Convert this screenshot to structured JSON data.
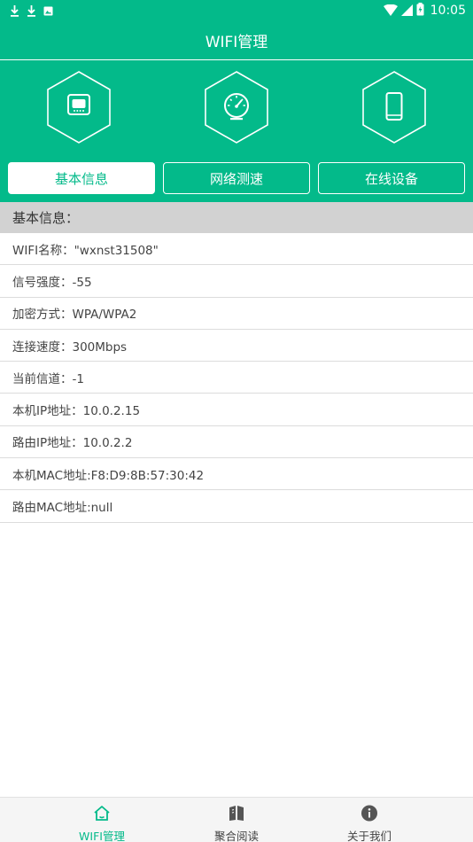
{
  "status_bar": {
    "time": "10:05",
    "left_icons": [
      "download-icon",
      "download-icon",
      "photo-icon"
    ],
    "right_icons": [
      "wifi-signal-icon",
      "cell-signal-icon",
      "battery-icon"
    ]
  },
  "title_bar": {
    "title": "WIFI管理"
  },
  "header": {
    "hex_icons": [
      "router-icon",
      "speedometer-icon",
      "phone-icon"
    ],
    "tabs": [
      {
        "label": "基本信息",
        "active": true
      },
      {
        "label": "网络测速",
        "active": false
      },
      {
        "label": "在线设备",
        "active": false
      }
    ]
  },
  "section": {
    "title": "基本信息：",
    "rows": [
      "WIFI名称：\"wxnst31508\"",
      "信号强度：-55",
      "加密方式：WPA/WPA2",
      "连接速度：300Mbps",
      "当前信道：-1",
      "本机IP地址：10.0.2.15",
      "路由IP地址：10.0.2.2",
      "本机MAC地址:F8:D9:8B:57:30:42",
      "路由MAC地址:null"
    ]
  },
  "bottom_nav": {
    "items": [
      {
        "label": "WIFI管理",
        "icon": "home-icon",
        "active": true
      },
      {
        "label": "聚合阅读",
        "icon": "book-icon",
        "active": false
      },
      {
        "label": "关于我们",
        "icon": "info-icon",
        "active": false
      }
    ]
  },
  "colors": {
    "primary": "#03ba8a",
    "section_header_bg": "#d2d2d2",
    "bottom_nav_bg": "#f5f5f5"
  }
}
